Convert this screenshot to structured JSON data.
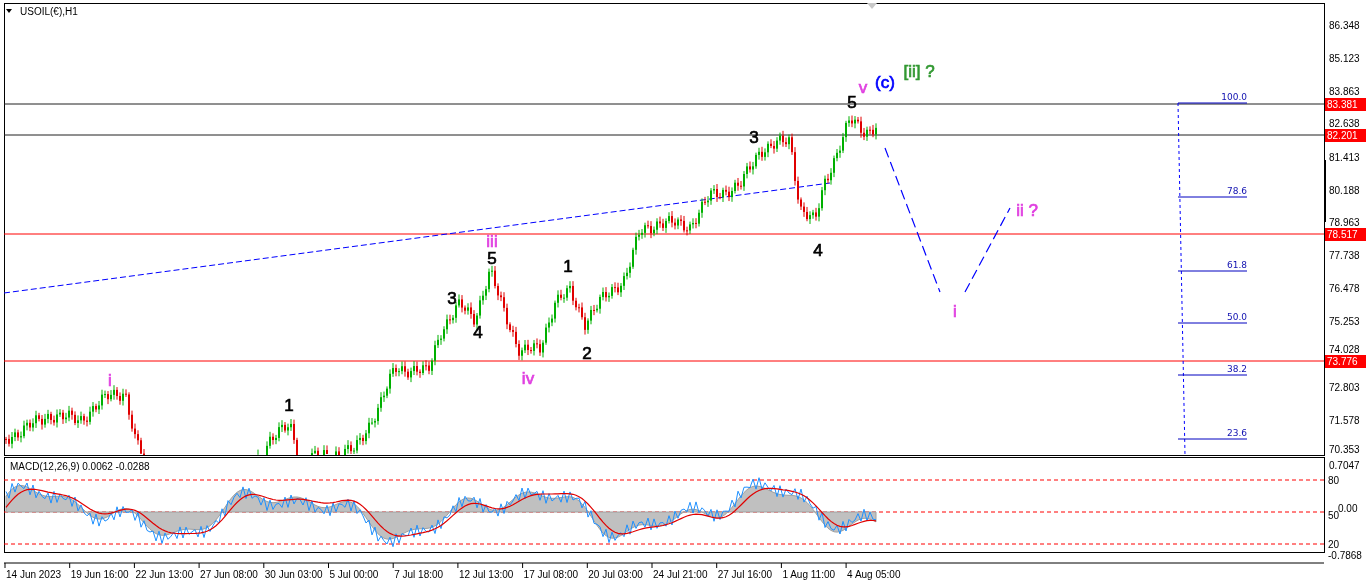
{
  "chart": {
    "symbol": "USOIL(€),H1",
    "price_axis": [
      "86.348",
      "85.123",
      "83.863",
      "82.638",
      "81.413",
      "80.188",
      "78.963",
      "77.738",
      "76.478",
      "75.253",
      "74.028",
      "72.803",
      "71.578",
      "70.353"
    ],
    "price_lines": [
      {
        "label": "83.381"
      },
      {
        "label": "82.201"
      },
      {
        "label": "78.517"
      },
      {
        "label": "73.776"
      }
    ],
    "fibonacci": [
      "100.0",
      "78.6",
      "61.8",
      "50.0",
      "38.2",
      "23.6"
    ],
    "wave_labels": [
      {
        "text": "i",
        "color": "#e040e0"
      },
      {
        "text": "1",
        "color": "#000000"
      },
      {
        "text": "3",
        "color": "#000000"
      },
      {
        "text": "4",
        "color": "#000000"
      },
      {
        "text": "5",
        "color": "#000000"
      },
      {
        "text": "iii",
        "color": "#e040e0"
      },
      {
        "text": "iv",
        "color": "#e040e0"
      },
      {
        "text": "1",
        "color": "#000000"
      },
      {
        "text": "2",
        "color": "#000000"
      },
      {
        "text": "3",
        "color": "#000000"
      },
      {
        "text": "4",
        "color": "#000000"
      },
      {
        "text": "5",
        "color": "#000000"
      },
      {
        "text": "v",
        "color": "#e040e0"
      },
      {
        "text": "(c)",
        "color": "#0000ff"
      },
      {
        "text": "[ii] ?",
        "color": "#339933"
      },
      {
        "text": "ii ?",
        "color": "#e040e0"
      },
      {
        "text": "i",
        "color": "#e040e0"
      }
    ]
  },
  "macd": {
    "title": "MACD(12,26,9) 0.0062 -0.0288",
    "axis": [
      "0.7047",
      "80",
      "50",
      "0.00",
      "20",
      "-0.7868"
    ]
  },
  "time_axis": [
    "14 Jun 2023",
    "19 Jun 16:00",
    "22 Jun 13:00",
    "27 Jun 08:00",
    "30 Jun 03:00",
    "5 Jul 00:00",
    "7 Jul 18:00",
    "12 Jul 13:00",
    "17 Jul 08:00",
    "20 Jul 03:00",
    "24 Jul 21:00",
    "27 Jul 16:00",
    "1 Aug 11:00",
    "4 Aug 05:00"
  ]
}
